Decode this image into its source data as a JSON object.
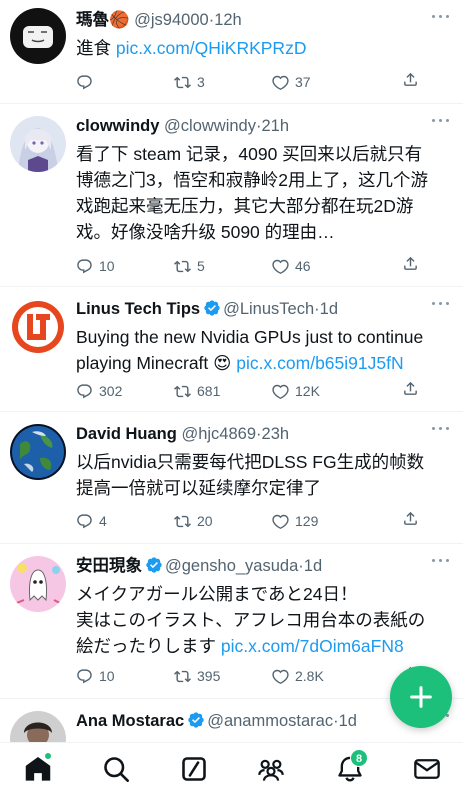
{
  "colors": {
    "accent": "#1cc07a",
    "link": "#1d9bf0",
    "text": "#0f1419",
    "muted": "#536471",
    "verified": "#1d9bf0"
  },
  "posts": [
    {
      "name": "瑪魯",
      "emoji": "🏀",
      "handle": "@js94000",
      "time": "12h",
      "verified": false,
      "text_lines": [
        "進食"
      ],
      "link": "pic.x.com/QHiKRKPRzD",
      "counts": {
        "reply": "",
        "repost": "3",
        "like": "37"
      }
    },
    {
      "name": "clowwindy",
      "handle": "@clowwindy",
      "time": "21h",
      "verified": false,
      "text_lines": [
        "看了下 steam 记录，4090 买回来以后就只有",
        "博德之门3，悟空和寂静岭2用上了，这几个游",
        "戏跑起来毫无压力，其它大部分都在玩2D游",
        "戏。好像没啥升级 5090 的理由…"
      ],
      "counts": {
        "reply": "10",
        "repost": "5",
        "like": "46"
      }
    },
    {
      "name": "Linus Tech Tips",
      "handle": "@LinusTech",
      "time": "1d",
      "verified": true,
      "text_lines": [
        "Buying the new Nvidia GPUs just to continue",
        "playing Minecraft"
      ],
      "emoji": "😍",
      "link": "pic.x.com/b65i91J5fN",
      "counts": {
        "reply": "302",
        "repost": "681",
        "like": "12K"
      }
    },
    {
      "name": "David Huang",
      "handle": "@hjc4869",
      "time": "23h",
      "verified": false,
      "text_lines": [
        "以后nvidia只需要每代把DLSS FG生成的帧数",
        "提高一倍就可以延续摩尔定律了"
      ],
      "counts": {
        "reply": "4",
        "repost": "20",
        "like": "129"
      }
    },
    {
      "name": "安田現象",
      "handle": "@gensho_yasuda",
      "time": "1d",
      "verified": true,
      "text_lines": [
        "メイクアガール公開まであと24日！",
        "実はこのイラスト、アフレコ用台本の表紙の",
        "絵だったりします"
      ],
      "link": "pic.x.com/7dOim6aFN8",
      "counts": {
        "reply": "10",
        "repost": "395",
        "like": "2.8K"
      }
    },
    {
      "name": "Ana Mostarac",
      "handle": "@anammostarac",
      "time": "1d",
      "verified": true
    }
  ],
  "separator": "·",
  "tabbar": {
    "items": [
      "home-icon",
      "search-icon",
      "grok-icon",
      "communities-icon",
      "notifications-icon",
      "messages-icon"
    ],
    "notifications_badge": "8"
  },
  "fab": {
    "icon": "plus-icon"
  }
}
